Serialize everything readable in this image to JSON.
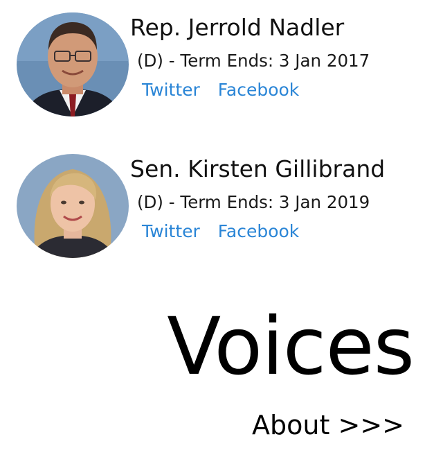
{
  "representatives": [
    {
      "name": "Rep. Jerrold Nadler",
      "term": "(D) - Term Ends: 3 Jan 2017",
      "links": {
        "twitter": "Twitter",
        "facebook": "Facebook"
      }
    },
    {
      "name": "Sen. Kirsten Gillibrand",
      "term": "(D) - Term Ends: 3 Jan 2019",
      "links": {
        "twitter": "Twitter",
        "facebook": "Facebook"
      }
    }
  ],
  "app": {
    "title": "Voices",
    "about_label": "About >>>"
  },
  "colors": {
    "link": "#2a85d6",
    "text": "#111111",
    "background": "#ffffff"
  }
}
